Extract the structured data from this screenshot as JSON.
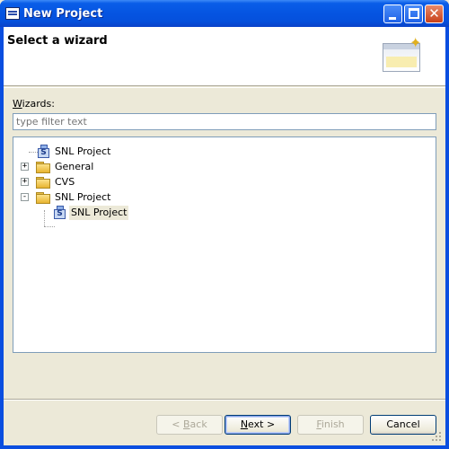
{
  "window": {
    "title": "New Project",
    "icon": "eclipse-app-icon"
  },
  "banner": {
    "title": "Select a wizard",
    "image_icon": "wizard-window-sparkle-icon"
  },
  "wizards": {
    "label_mnemonic": "W",
    "label_rest": "izards:",
    "filter_placeholder": "type filter text"
  },
  "tree": {
    "items": [
      {
        "label": "SNL Project",
        "icon": "snl-project-icon",
        "expander": "none",
        "level": 0
      },
      {
        "label": "General",
        "icon": "folder-icon",
        "expander": "+",
        "level": 0
      },
      {
        "label": "CVS",
        "icon": "folder-icon",
        "expander": "+",
        "level": 0
      },
      {
        "label": "SNL Project",
        "icon": "folder-icon",
        "expander": "-",
        "level": 0
      },
      {
        "label": "SNL Project",
        "icon": "snl-project-icon",
        "expander": "none",
        "level": 1,
        "selected": true
      }
    ]
  },
  "buttons": {
    "back_prefix": "< ",
    "back_mnemonic": "B",
    "back_rest": "ack",
    "next_mnemonic": "N",
    "next_rest": "ext >",
    "finish_mnemonic": "F",
    "finish_rest": "inish",
    "cancel": "Cancel"
  }
}
